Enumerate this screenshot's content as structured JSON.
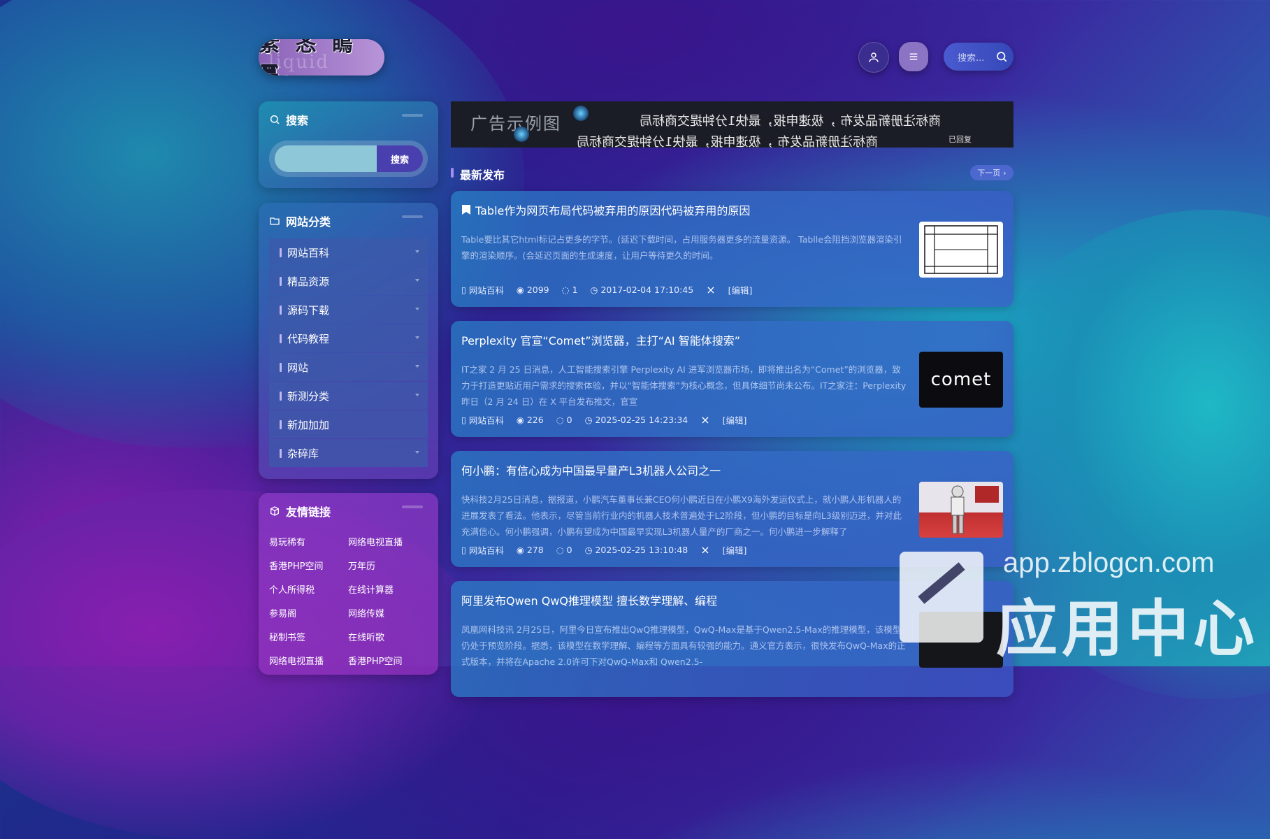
{
  "header": {
    "logo_text": "素 忞 瞗 靐",
    "logo_ghost": "liquid Gloss",
    "search_placeholder": "搜索..."
  },
  "sidebar": {
    "search": {
      "title": "搜索",
      "button_label": "搜索"
    },
    "categories": {
      "title": "网站分类",
      "items": [
        {
          "label": "网站百科"
        },
        {
          "label": "精品资源"
        },
        {
          "label": "源码下载"
        },
        {
          "label": "代码教程"
        },
        {
          "label": "网站"
        },
        {
          "label": "新测分类"
        },
        {
          "label": "新加加加"
        },
        {
          "label": "杂碎库"
        }
      ]
    },
    "links": {
      "title": "友情链接",
      "items": [
        {
          "label": "易玩稀有"
        },
        {
          "label": "网络电视直播"
        },
        {
          "label": "香港PHP空间"
        },
        {
          "label": "万年历"
        },
        {
          "label": "个人所得税"
        },
        {
          "label": "在线计算器"
        },
        {
          "label": "参易阁"
        },
        {
          "label": "网络传媒"
        },
        {
          "label": "秘制书签"
        },
        {
          "label": "在线听歌"
        },
        {
          "label": "网络电视直播"
        },
        {
          "label": "香港PHP空间"
        }
      ]
    }
  },
  "banner": {
    "label": "广告示例图",
    "line1": "商标注册新品发布 ，极速申报，最快1分钟提交商标局",
    "line2": "商标注册新品发布 ，极速申报，最快1分钟提交商标局",
    "corner_text": "已回复"
  },
  "section": {
    "title": "最新发布",
    "next_label": "下一页"
  },
  "posts": [
    {
      "title": "Table作为网页布局代码被弃用的原因代码被弃用的原因",
      "excerpt": "Table要比其它html标记占更多的字节。(延迟下载时间，占用服务器更多的流量资源。 Tablle会阻挡浏览器渲染引擎的渲染顺序。(会延迟页面的生成速度，让用户等待更久的时间。",
      "category": "网站百科",
      "views": "2099",
      "comments": "1",
      "date": "2017-02-04 17:10:45",
      "edit": "[编辑]"
    },
    {
      "title": "Perplexity 官宣“Comet”浏览器，主打“AI 智能体搜索”",
      "excerpt": "IT之家 2 月 25 日消息，人工智能搜索引擎 Perplexity AI 进军浏览器市场，即将推出名为“Comet”的浏览器，致力于打造更贴近用户需求的搜索体验，并以“智能体搜索”为核心概念，但具体细节尚未公布。IT之家注：Perplexity 昨日（2 月 24 日）在 X 平台发布推文，官宣",
      "category": "网站百科",
      "views": "226",
      "comments": "0",
      "date": "2025-02-25 14:23:34",
      "edit": "[编辑]",
      "thumb_text": "comet"
    },
    {
      "title": "何小鹏：有信心成为中国最早量产L3机器人公司之一",
      "excerpt": "快科技2月25日消息，据报道，小鹏汽车董事长兼CEO何小鹏近日在小鹏X9海外发运仪式上，就小鹏人形机器人的进展发表了看法。他表示，尽管当前行业内的机器人技术普遍处于L2阶段，但小鹏的目标是向L3级别迈进，并对此充满信心。何小鹏强调，小鹏有望成为中国最早实现L3机器人量产的厂商之一。何小鹏进一步解释了",
      "category": "网站百科",
      "views": "278",
      "comments": "0",
      "date": "2025-02-25 13:10:48",
      "edit": "[编辑]"
    },
    {
      "title": "阿里发布Qwen QwQ推理模型 擅长数学理解、编程",
      "excerpt": "凤凰网科技讯 2月25日，阿里今日宣布推出QwQ推理模型，QwQ-Max是基于Qwen2.5-Max的推理模型，该模型仍处于预览阶段。据悉，该模型在数学理解、编程等方面具有较强的能力。通义官方表示，很快发布QwQ-Max的正式版本，并将在Apache 2.0许可下对QwQ-Max和 Qwen2.5-",
      "category": "网站百科",
      "views": "",
      "comments": "",
      "date": "",
      "edit": ""
    }
  ],
  "watermark": {
    "url": "app.zblogcn.com",
    "text": "应用中心"
  }
}
